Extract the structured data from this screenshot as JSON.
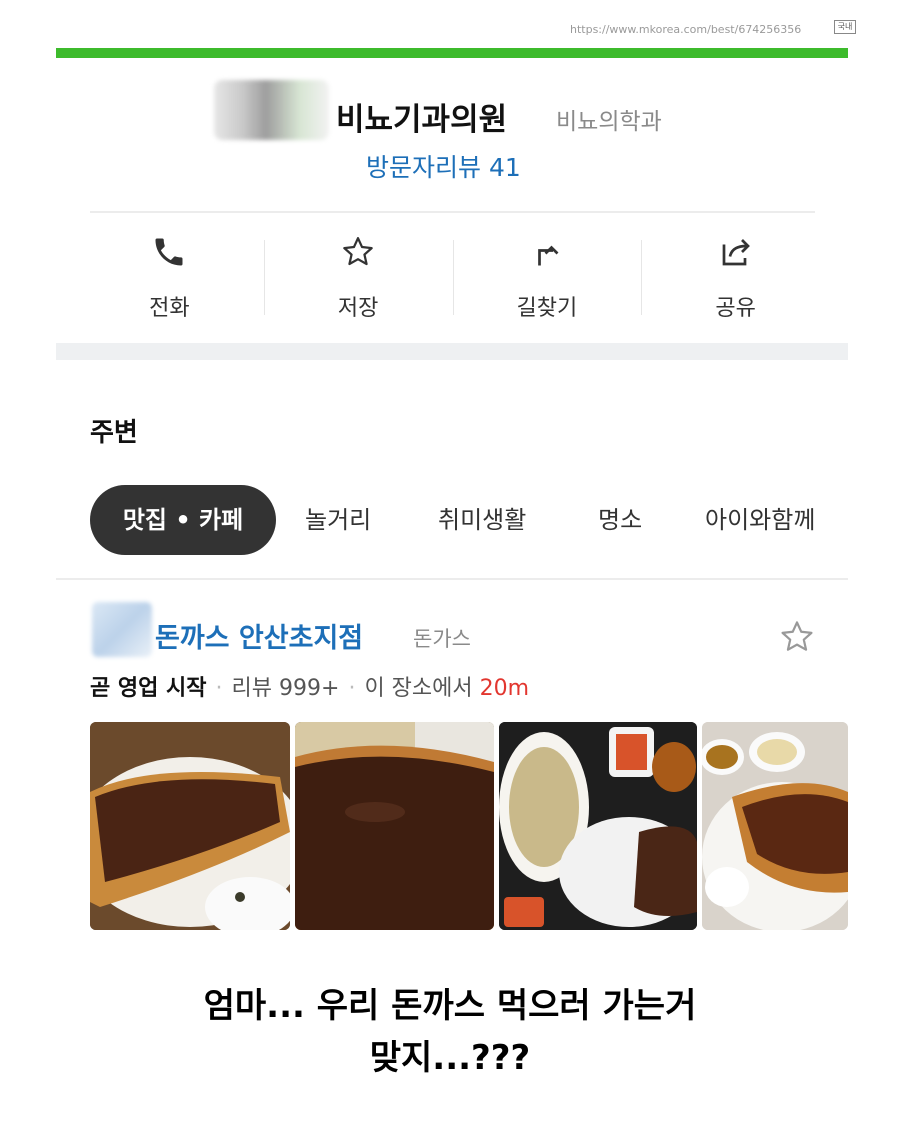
{
  "browser": {
    "url": "https://www.mkorea.com/best/674256356",
    "ext_badge": "국내"
  },
  "place": {
    "name": "비뇨기과의원",
    "category": "비뇨의학과",
    "review_link": "방문자리뷰 41"
  },
  "actions": [
    {
      "label": "전화",
      "icon": "phone-icon"
    },
    {
      "label": "저장",
      "icon": "star-icon"
    },
    {
      "label": "길찾기",
      "icon": "directions-icon"
    },
    {
      "label": "공유",
      "icon": "share-icon"
    }
  ],
  "nearby": {
    "title": "주변",
    "chips": [
      "맛집 • 카페",
      "놀거리",
      "취미생활",
      "명소",
      "아이와함께"
    ],
    "active_chip": 0
  },
  "result": {
    "name": "돈까스 안산초지점",
    "category": "돈가스",
    "status": "곧 영업 시작",
    "reviews": "리뷰 999+",
    "distance_label": "이 장소에서",
    "distance": "20m"
  },
  "caption": {
    "line1": "엄마... 우리 돈까스 먹으러 가는거",
    "line2": "맞지...???"
  },
  "colors": {
    "brand_green": "#3dbb2c",
    "link_blue": "#1d6fb8",
    "distance_red": "#e2362f",
    "chip_active": "#333333"
  }
}
